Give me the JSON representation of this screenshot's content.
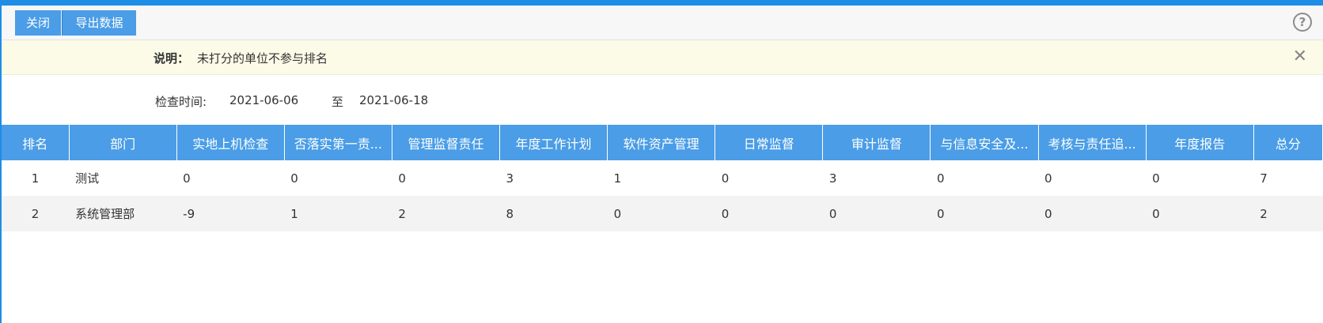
{
  "toolbar": {
    "close_label": "关闭",
    "export_label": "导出数据",
    "help_icon": "question-circle-icon"
  },
  "notice": {
    "label": "说明：",
    "text": "未打分的单位不参与排名",
    "close_icon": "close-icon"
  },
  "date_filter": {
    "label": "检查时间:",
    "from": "2021-06-06",
    "to_label": "至",
    "to": "2021-06-18"
  },
  "table": {
    "headers": [
      "排名",
      "部门",
      "实地上机检查",
      "否落实第一责...",
      "管理监督责任",
      "年度工作计划",
      "软件资产管理",
      "日常监督",
      "审计监督",
      "与信息安全及...",
      "考核与责任追...",
      "年度报告",
      "总分"
    ],
    "rows": [
      [
        "1",
        "测试",
        "0",
        "0",
        "0",
        "3",
        "1",
        "0",
        "3",
        "0",
        "0",
        "0",
        "7"
      ],
      [
        "2",
        "系统管理部",
        "-9",
        "1",
        "2",
        "8",
        "0",
        "0",
        "0",
        "0",
        "0",
        "0",
        "2"
      ]
    ]
  },
  "colors": {
    "accent": "#1e8de6",
    "header_bg": "#4a9de6",
    "notice_bg": "#fbfbe8"
  }
}
